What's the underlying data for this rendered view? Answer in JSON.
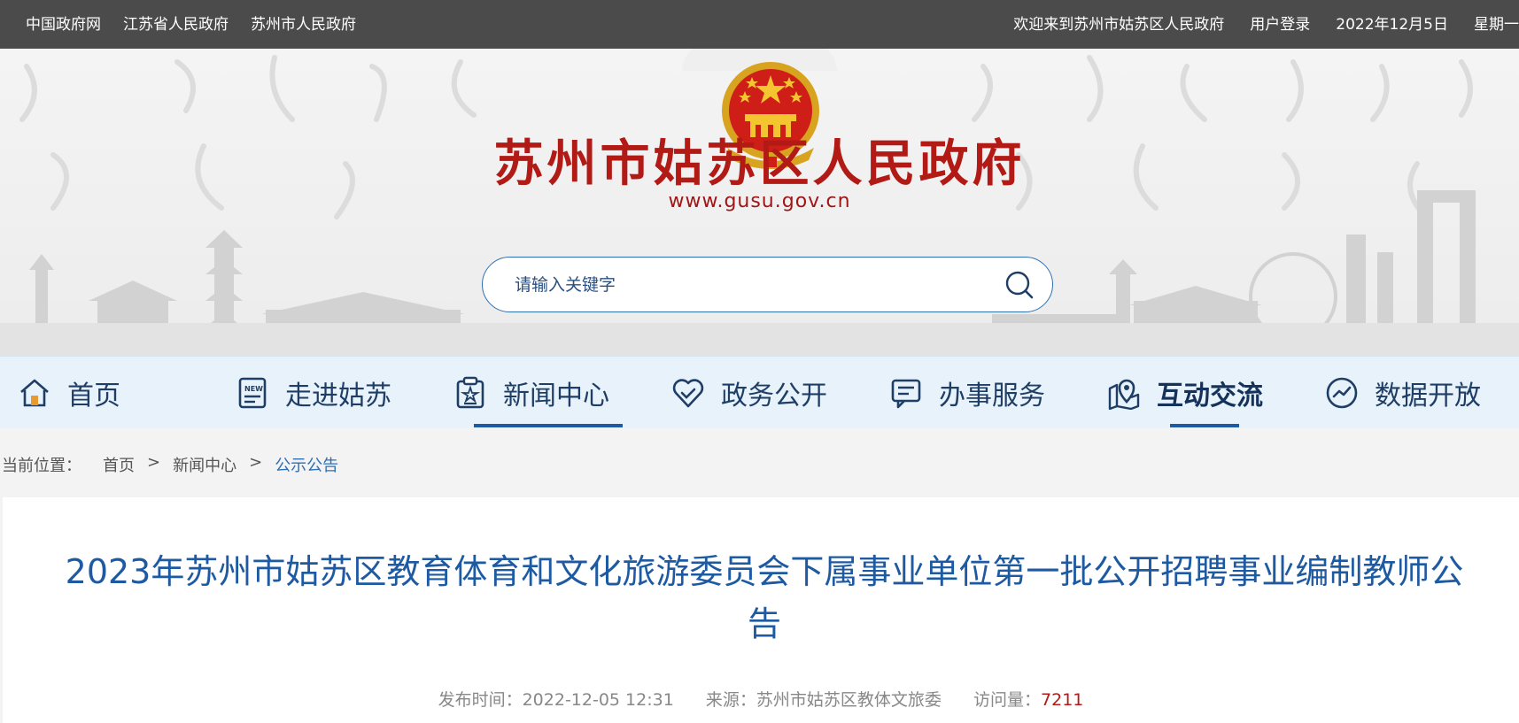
{
  "topbar": {
    "links": [
      "中国政府网",
      "江苏省人民政府",
      "苏州市人民政府"
    ],
    "welcome": "欢迎来到苏州市姑苏区人民政府",
    "login": "用户登录",
    "date": "2022年12月5日",
    "weekday": "星期一"
  },
  "header": {
    "site_title": "苏州市姑苏区人民政府",
    "site_url": "www.gusu.gov.cn"
  },
  "search": {
    "placeholder": "请输入关键字"
  },
  "nav": {
    "items": [
      {
        "label": "首页",
        "icon": "home-icon"
      },
      {
        "label": "走进姑苏",
        "icon": "news-document-icon"
      },
      {
        "label": "新闻中心",
        "icon": "clipboard-star-icon"
      },
      {
        "label": "政务公开",
        "icon": "heart-check-icon"
      },
      {
        "label": "办事服务",
        "icon": "chat-bubble-icon"
      },
      {
        "label": "互动交流",
        "icon": "map-pin-icon"
      },
      {
        "label": "数据开放",
        "icon": "chart-line-icon"
      }
    ],
    "active": "新闻中心"
  },
  "breadcrumb": {
    "prefix": "当前位置：",
    "items": [
      "首页",
      "新闻中心",
      "公示公告"
    ],
    "separator": ">"
  },
  "article": {
    "title": "2023年苏州市姑苏区教育体育和文化旅游委员会下属事业单位第一批公开招聘事业编制教师公告",
    "publish_label": "发布时间：",
    "publish_time": "2022-12-05 12:31",
    "source_label": "来源：",
    "source": "苏州市姑苏区教体文旅委",
    "views_label": "访问量：",
    "views": "7211"
  },
  "colors": {
    "topbar": "#4b4b4b",
    "title_red": "#b21a16",
    "accent_blue": "#1e5aa2",
    "nav_bg": "#e8f2fb"
  }
}
